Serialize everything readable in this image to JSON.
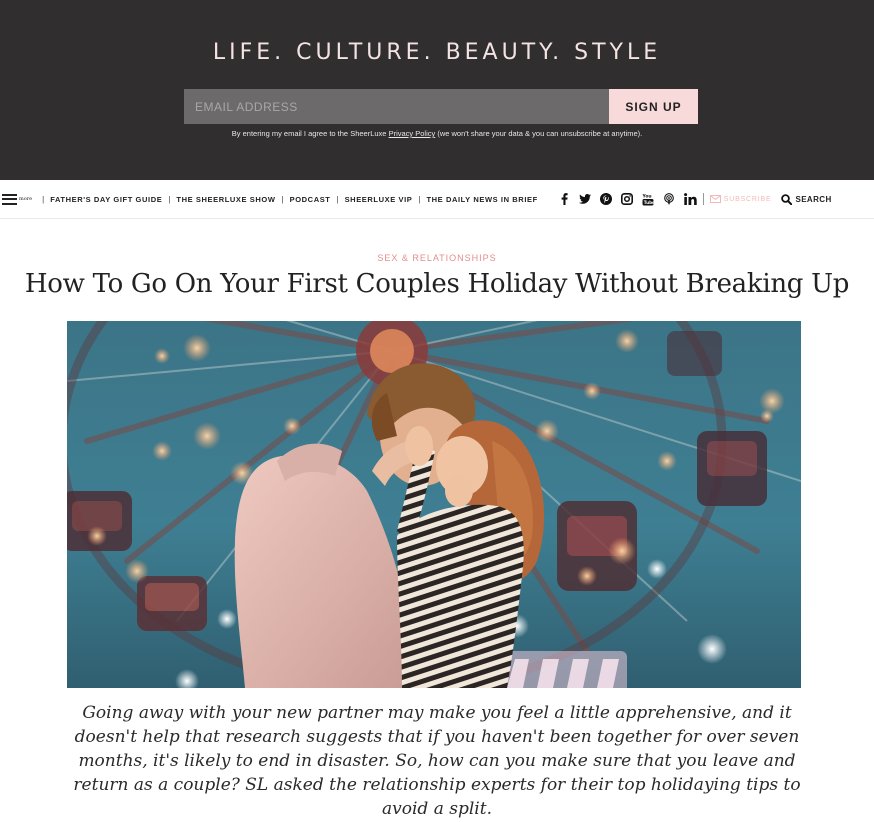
{
  "banner": {
    "tagline": "LIFE. CULTURE. BEAUTY. STYLE",
    "email_placeholder": "EMAIL ADDRESS",
    "email_value": "",
    "signup_label": "SIGN UP",
    "consent_before": "By entering my email I agree to the SheerLuxe ",
    "consent_link": "Privacy Policy",
    "consent_after": " (we won't share your data & you can unsubscribe at anytime)."
  },
  "nav": {
    "more_label": "more",
    "links": [
      "FATHER'S DAY GIFT GUIDE",
      "THE SHEERLUXE SHOW",
      "PODCAST",
      "SHEERLUXE VIP",
      "THE DAILY NEWS IN BRIEF"
    ],
    "social_icons": [
      "facebook-icon",
      "twitter-icon",
      "pinterest-icon",
      "instagram-icon",
      "youtube-icon",
      "podcast-icon",
      "linkedin-icon"
    ],
    "subscribe_label": "SUBSCRIBE",
    "search_label": "SEARCH"
  },
  "article": {
    "category": "SEX & RELATIONSHIPS",
    "title": "How To Go On Your First Couples Holiday Without Breaking Up",
    "standfirst": "Going away with your new partner may make you feel a little apprehensive, and it doesn't help that research suggests that if you haven't been together for over seven months, it's likely to end in disaster. So, how can you make sure that you leave and return as a couple? SL asked the relationship experts for their top holidaying tips to avoid a split."
  },
  "colors": {
    "banner_bg": "#302e2e",
    "signup_bg": "#f8dada",
    "accent_pink": "#e48e8e"
  }
}
